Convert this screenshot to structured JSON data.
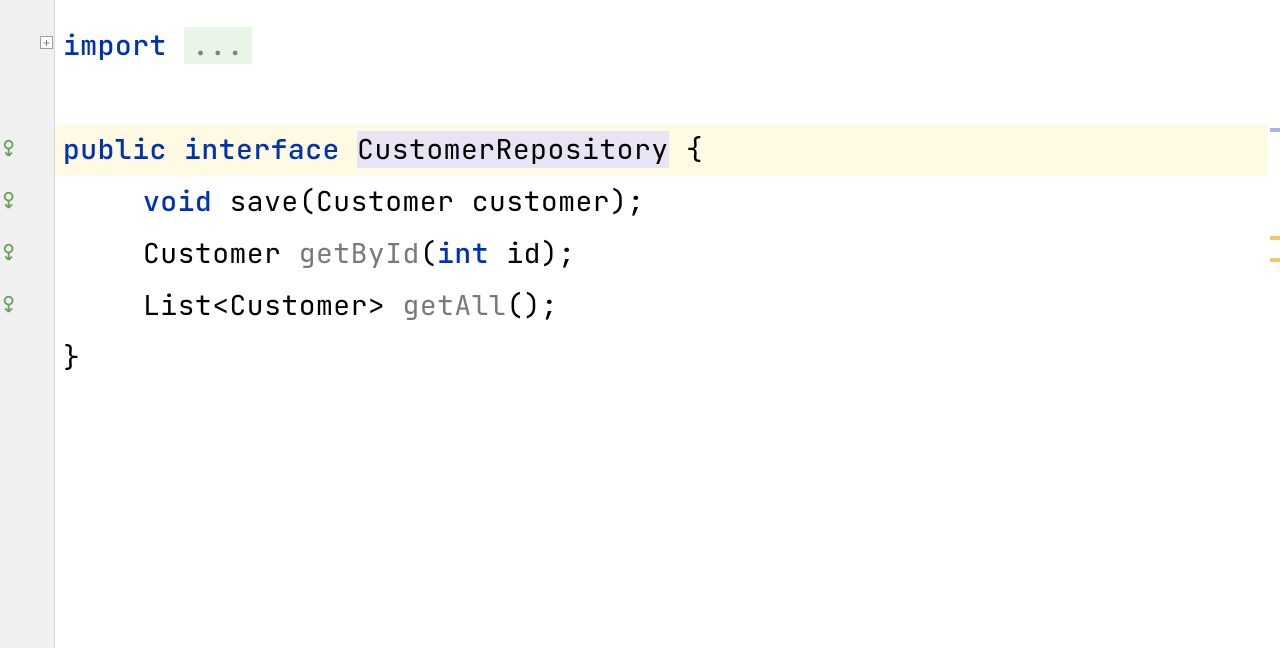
{
  "gutter": {
    "fold_plus": "+"
  },
  "code": {
    "import_kw": "import",
    "folded": "...",
    "public_kw": "public",
    "interface_kw": "interface",
    "interface_name": "CustomerRepository",
    "brace_open": " {",
    "void_kw": "void",
    "save_sig": " save(Customer customer);",
    "customer_type": "Customer ",
    "getById_name": "getById",
    "getById_paren_open": "(",
    "int_kw": "int",
    "getById_rest": " id);",
    "list_type": "List<Customer> ",
    "getAll_name": "getAll",
    "getAll_rest": "();",
    "brace_close": "}"
  }
}
